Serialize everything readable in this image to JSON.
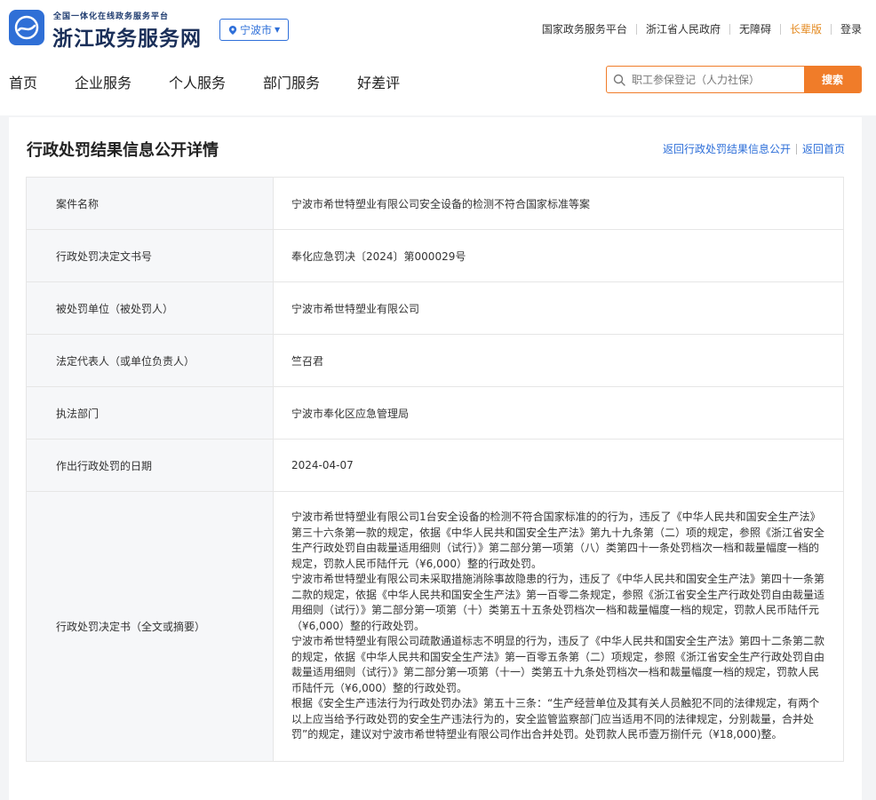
{
  "header": {
    "logo_tagline": "全国一体化在线政务服务平台",
    "logo_title": "浙江政务服务网",
    "city": "宁波市",
    "top_links": [
      "国家政务服务平台",
      "浙江省人民政府",
      "无障碍",
      "长辈版",
      "登录"
    ],
    "nav": [
      "首页",
      "企业服务",
      "个人服务",
      "部门服务",
      "好差评"
    ],
    "search": {
      "placeholder": "职工参保登记（人力社保）",
      "button": "搜索"
    },
    "colors": {
      "brand_blue": "#2e6fd9",
      "accent_orange": "#f07c29",
      "elder_orange": "#e48a21"
    }
  },
  "page": {
    "title": "行政处罚结果信息公开详情",
    "back_to_list": "返回行政处罚结果信息公开",
    "back_home": "返回首页"
  },
  "details": [
    {
      "label": "案件名称",
      "value": "宁波市希世特塑业有限公司安全设备的检测不符合国家标准等案"
    },
    {
      "label": "行政处罚决定文书号",
      "value": "奉化应急罚决〔2024〕第000029号"
    },
    {
      "label": "被处罚单位（被处罚人）",
      "value": "宁波市希世特塑业有限公司"
    },
    {
      "label": "法定代表人（或单位负责人）",
      "value": "竺召君"
    },
    {
      "label": "执法部门",
      "value": "宁波市奉化区应急管理局"
    },
    {
      "label": "作出行政处罚的日期",
      "value": "2024-04-07"
    }
  ],
  "decision": {
    "label": "行政处罚决定书（全文或摘要）",
    "paragraphs": [
      "宁波市希世特塑业有限公司1台安全设备的检测不符合国家标准的的行为，违反了《中华人民共和国安全生产法》第三十六条第一款的规定，依据《中华人民共和国安全生产法》第九十九条第（二）项的规定，参照《浙江省安全生产行政处罚自由裁量适用细则（试行）》第二部分第一项第（八）类第四十一条处罚档次一档和裁量幅度一档的规定，罚款人民币陆仟元（¥6,000）整的行政处罚。",
      "宁波市希世特塑业有限公司未采取措施消除事故隐患的行为，违反了《中华人民共和国安全生产法》第四十一条第二款的规定，依据《中华人民共和国安全生产法》第一百零二条规定，参照《浙江省安全生产行政处罚自由裁量适用细则（试行）》第二部分第一项第（十）类第五十五条处罚档次一档和裁量幅度一档的规定，罚款人民币陆仟元（¥6,000）整的行政处罚。",
      "宁波市希世特塑业有限公司疏散通道标志不明显的行为，违反了《中华人民共和国安全生产法》第四十二条第二款的规定，依据《中华人民共和国安全生产法》第一百零五条第（二）项规定，参照《浙江省安全生产行政处罚自由裁量适用细则（试行）》第二部分第一项第（十一）类第五十九条处罚档次一档和裁量幅度一档的规定，罚款人民币陆仟元（¥6,000）整的行政处罚。",
      "根据《安全生产违法行为行政处罚办法》第五十三条：“生产经营单位及其有关人员触犯不同的法律规定，有两个以上应当给予行政处罚的安全生产违法行为的，安全监管监察部门应当适用不同的法律规定，分别裁量，合并处罚”的规定，建议对宁波市希世特塑业有限公司作出合并处罚。处罚款人民币壹万捌仟元（¥18,000)整。"
    ]
  }
}
